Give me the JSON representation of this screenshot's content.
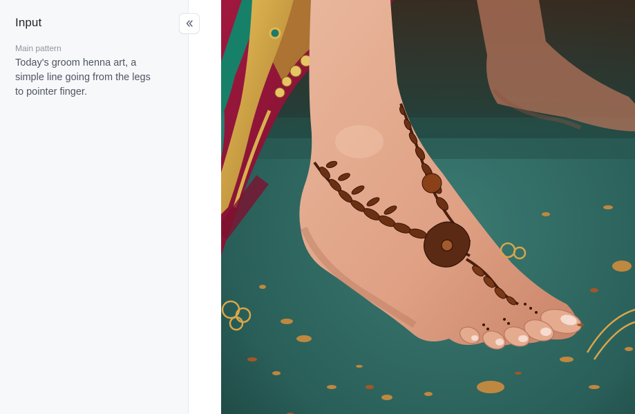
{
  "panel": {
    "title": "Input",
    "collapse_icon": "double-chevron-left-icon"
  },
  "fields": [
    {
      "label": "Main pattern",
      "value": "Today's groom henna art, a simple line going from the legs to pointer finger."
    }
  ],
  "result_image": {
    "subject": "henna-decorated foot on teal carpet with saree border"
  },
  "colors": {
    "sidebar_bg": "#f7f8fa",
    "title_text": "#1f2329",
    "label_text": "#8f959e",
    "value_text": "#4e5562",
    "carpet": "#2f6b64",
    "saree": "#8e1538",
    "gold": "#c99a3a",
    "skin": "#e3a98d",
    "henna": "#5a2a14"
  }
}
